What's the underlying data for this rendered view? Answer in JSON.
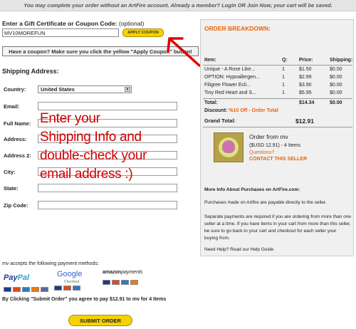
{
  "banner": {
    "text": "You may complete your order without an ArtFire account. Already a member? Login OR Join Now, your cart will be saved."
  },
  "coupon": {
    "label": "Enter a Gift Certificate or Coupon Code:",
    "optional": "(optional)",
    "value": "MV10MOREFUN",
    "apply_label": "APPLY COUPON",
    "reminder": "Have a coupon? Make sure you click the yellow \"Apply Coupon\" button!"
  },
  "shipping": {
    "title": "Shipping Address:",
    "country_label": "Country:",
    "country_value": "United States",
    "email_label": "Email:",
    "fullname_label": "Full Name:",
    "address_label": "Address:",
    "address2_label": "Address 2:",
    "city_label": "City:",
    "state_label": "State:",
    "zip_label": "Zip Code:"
  },
  "annotation": {
    "line1": "Enter your",
    "line2": "Shipping Info and",
    "line3": "double-check your",
    "line4": "email address :)",
    "color": "#d10000"
  },
  "order": {
    "title": "ORDER BREAKDOWN:",
    "headers": {
      "item": "Item:",
      "q": "Q:",
      "price": "Price:",
      "shipping": "Shipping:"
    },
    "items": [
      {
        "name": "Unique - A Rose Like...",
        "q": "1",
        "price": "$1.50",
        "shipping": "$0.00"
      },
      {
        "name": "OPTION: Hypoallergen...",
        "q": "1",
        "price": "$2.99",
        "shipping": "$0.00"
      },
      {
        "name": "Filigree Flower Ecli...",
        "q": "1",
        "price": "$3.90",
        "shipping": "$0.00"
      },
      {
        "name": "Tiny Red Heart and S...",
        "q": "1",
        "price": "$5.95",
        "shipping": "$0.00"
      }
    ],
    "subtotal_label": "Total:",
    "subtotal": "$14.34",
    "subtotal_shipping": "$0.00",
    "discount_label": "Discount:",
    "discount_value": "%10 Off - Order Total",
    "grand_label": "Grand Total:",
    "grand_value": "$12.91",
    "seller": {
      "from": "Order from mv",
      "usd": "($USD 12.91) - 4 Items",
      "questions": "Questions?",
      "contact": "CONTACT THIS SELLER"
    },
    "info_title": "More Info About Purchases on ArtFire.com:",
    "info_p1": "Purchases made on Artfire are payable directly to the seller.",
    "info_p2": "Separate payments are required if you are ordering from more than one seller at a time. If you have items in your cart from more than this seller, be sure to go back to your cart and checkout for each seller your buying from.",
    "help": "Need Help? Read our Help Guide",
    "accent": "#e8640c"
  },
  "payment": {
    "label": "mv accepts the following payment methods:",
    "paypal_a": "Pay",
    "paypal_b": "Pal",
    "google": "Google",
    "google_sub": "Checkout",
    "amazon_a": "amazon",
    "amazon_b": "payments",
    "agree": "By Clicking \"Submit Order\" you agree to pay $12.91 to mv for 4 Items",
    "submit_label": "SUBMIT ORDER"
  }
}
